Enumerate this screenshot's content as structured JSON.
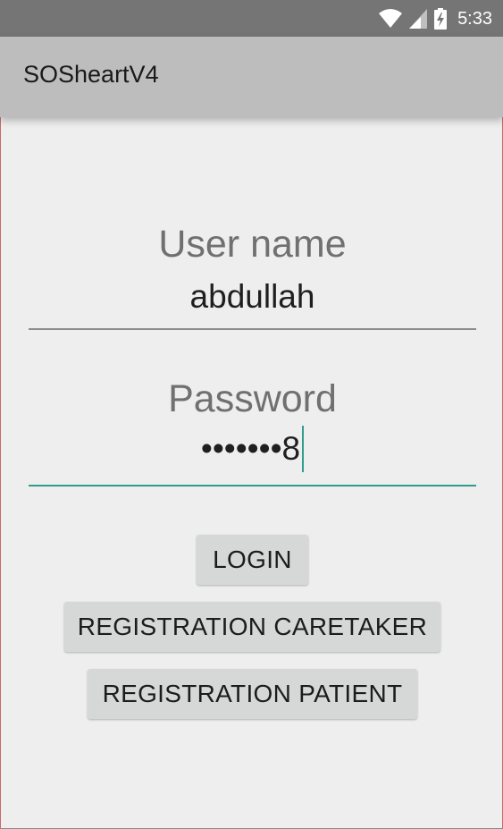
{
  "status_bar": {
    "time": "5:33",
    "icons": [
      "wifi-icon",
      "signal-icon",
      "battery-charging-icon"
    ]
  },
  "app_bar": {
    "title": "SOSheartV4"
  },
  "login_form": {
    "username": {
      "label": "User name",
      "value": "abdullah"
    },
    "password": {
      "label": "Password",
      "masked_value": "•••••••8"
    }
  },
  "buttons": {
    "login": "LOGIN",
    "registration_caretaker": "REGISTRATION CARETAKER",
    "registration_patient": "REGISTRATION PATIENT"
  },
  "colors": {
    "status_bar": "#757575",
    "app_bar": "#bdbdbd",
    "background": "#eeeeee",
    "accent": "#2f9c8c",
    "button": "#d6d7d7"
  }
}
